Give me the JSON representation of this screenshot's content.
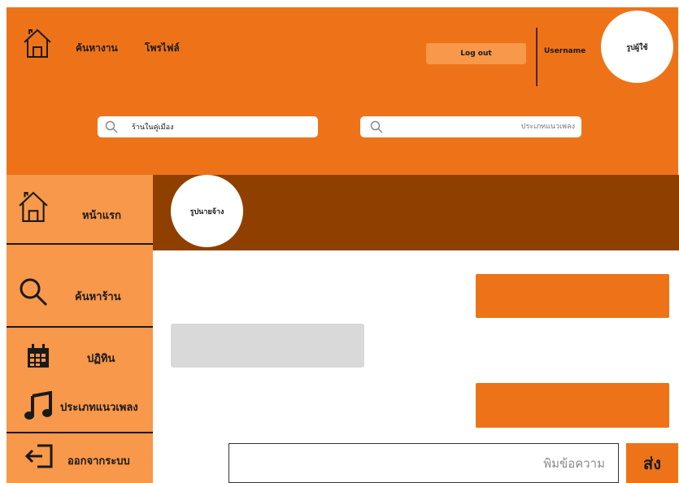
{
  "header": {
    "nav": {
      "find_job": "ค้นหางาน",
      "profile": "โพรไฟล์"
    },
    "logout_label": "Log out",
    "username": "Username",
    "avatar_label": "รูปผู้ใช้",
    "search_shop": {
      "value": "ร้านในคู่เมือง",
      "placeholder": ""
    },
    "search_genre": {
      "value": "",
      "placeholder": "ประเภทแนวเพลง"
    }
  },
  "sidebar": {
    "items": [
      {
        "label": "หน้าแรก",
        "icon": "home-icon"
      },
      {
        "label": "ค้นหาร้าน",
        "icon": "search-icon"
      },
      {
        "label": "ปฏิทิน",
        "icon": "calendar-icon"
      },
      {
        "label": "ประเภทแนวเพลง",
        "icon": "music-icon"
      },
      {
        "label": "ออกจากระบบ",
        "icon": "logout-icon"
      }
    ]
  },
  "chat": {
    "employer_avatar_label": "รูปนายจ้าง",
    "message_placeholder": "พิมข้อความ",
    "send_label": "ส่ง"
  },
  "colors": {
    "primary": "#ee7318",
    "sidebar": "#f7984a",
    "banner": "#8f4001",
    "incoming_bubble": "#d9d9d9"
  }
}
